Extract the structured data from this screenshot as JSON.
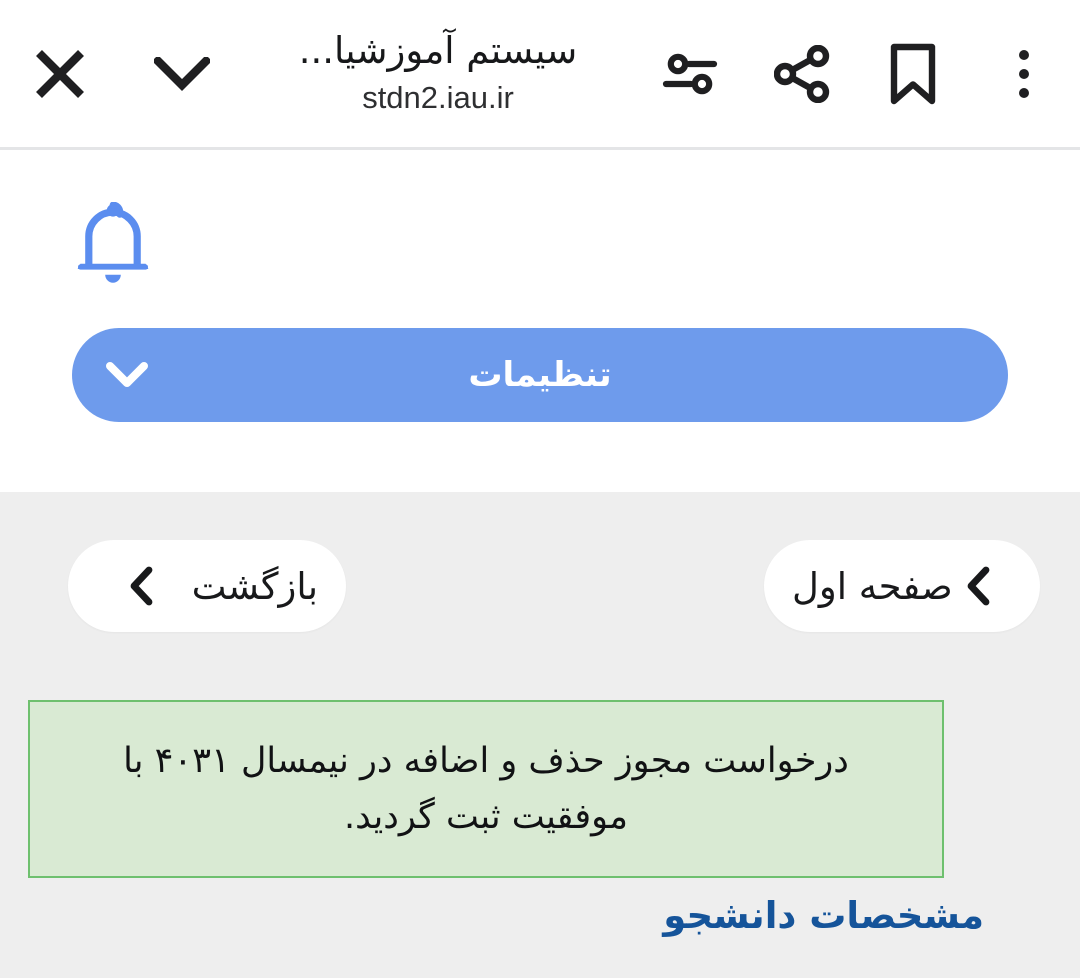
{
  "browser": {
    "title": "سیستم آموزشیا...",
    "url": "stdn2.iau.ir",
    "icons": {
      "overflow": "overflow-menu-icon",
      "bookmark": "bookmark-icon",
      "share": "share-icon",
      "tune": "tune-icon",
      "collapse": "chevron-down-icon",
      "close": "close-icon"
    }
  },
  "notification_panel": {
    "bell_icon": "bell-icon",
    "settings_button": {
      "label": "تنظیمات",
      "chevron_icon": "chevron-down-icon",
      "background_color": "#6e9bec",
      "text_color": "#ffffff"
    }
  },
  "page": {
    "background_color": "#eeeeee",
    "nav": {
      "home_button": {
        "label": "صفحه اول",
        "chevron_icon": "chevron-right-icon"
      },
      "back_button": {
        "label": "بازگشت",
        "chevron_icon": "chevron-left-icon"
      }
    },
    "alert": {
      "type": "success",
      "message": "درخواست مجوز حذف و اضافه در نیمسال ۴۰۳۱ با موفقیت ثبت گردید.",
      "semester_code": "۴۰۳۱",
      "background_color": "#d9ead3",
      "border_color": "#6ec06e"
    },
    "section_link": {
      "label": "مشخصات دانشجو",
      "color": "#15549a"
    }
  }
}
